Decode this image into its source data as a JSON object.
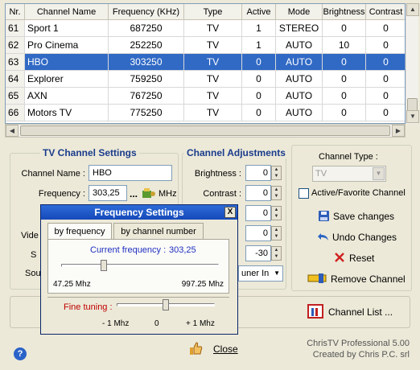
{
  "table": {
    "headers": [
      "Nr.",
      "Channel Name",
      "Frequency (KHz)",
      "Type",
      "Active",
      "Mode",
      "Brightness",
      "Contrast"
    ],
    "rows": [
      {
        "nr": "61",
        "name": "Sport 1",
        "freq": "687250",
        "type": "TV",
        "active": "1",
        "mode": "STEREO",
        "brightness": "0",
        "contrast": "0"
      },
      {
        "nr": "62",
        "name": "Pro Cinema",
        "freq": "252250",
        "type": "TV",
        "active": "1",
        "mode": "AUTO",
        "brightness": "10",
        "contrast": "0"
      },
      {
        "nr": "63",
        "name": "HBO",
        "freq": "303250",
        "type": "TV",
        "active": "0",
        "mode": "AUTO",
        "brightness": "0",
        "contrast": "0"
      },
      {
        "nr": "64",
        "name": "Explorer",
        "freq": "759250",
        "type": "TV",
        "active": "0",
        "mode": "AUTO",
        "brightness": "0",
        "contrast": "0"
      },
      {
        "nr": "65",
        "name": "AXN",
        "freq": "767250",
        "type": "TV",
        "active": "0",
        "mode": "AUTO",
        "brightness": "0",
        "contrast": "0"
      },
      {
        "nr": "66",
        "name": "Motors TV",
        "freq": "775250",
        "type": "TV",
        "active": "0",
        "mode": "AUTO",
        "brightness": "0",
        "contrast": "0"
      }
    ],
    "selected_index": 2
  },
  "tv_settings": {
    "title": "TV Channel Settings",
    "channel_name_label": "Channel Name :",
    "channel_name_value": "HBO",
    "frequency_label": "Frequency :",
    "frequency_value": "303,25",
    "frequency_dots": "...",
    "frequency_unit": "MHz",
    "video_label_partial": "Vide",
    "s_label_partial": "S",
    "sou_label_partial": "Sou"
  },
  "adjustments": {
    "title": "Channel Adjustments",
    "brightness_label": "Brightness :",
    "brightness_value": "0",
    "contrast_label": "Contrast :",
    "contrast_value": "0",
    "row3_value": "0",
    "row4_value": "0",
    "row5_value": "-30",
    "tuner_label_partial": "uner In"
  },
  "right_panel": {
    "channel_type_label": "Channel Type :",
    "channel_type_value": "TV",
    "favorite_label": "Active/Favorite Channel",
    "save_label": "Save changes",
    "undo_label": "Undo Changes",
    "reset_label": "Reset",
    "remove_label": "Remove Channel"
  },
  "bottom": {
    "channel_list_label": "Channel List ...",
    "close_label": "Close",
    "app_name": "ChrisTV Professional 5.00",
    "credit": "Created by Chris P.C. srl"
  },
  "dialog": {
    "title": "Frequency Settings",
    "close_glyph": "X",
    "tab1": "by frequency",
    "tab2": "by channel number",
    "current_label": "Current frequency :",
    "current_value": "303,25",
    "range_min": "47.25 Mhz",
    "range_max": "997.25 Mhz",
    "fine_label": "Fine tuning :",
    "fine_min": "- 1 Mhz",
    "fine_mid": "0",
    "fine_max": "+ 1 Mhz",
    "frequency_position": 0.268,
    "fine_position": 0.5
  },
  "colors": {
    "selection": "#316ac5",
    "group_title": "#1a3c8c",
    "fine_tuning": "#c00000",
    "current_freq": "#1f2fbf"
  },
  "icons": [
    "frequency-tune-icon",
    "save-disk-icon",
    "undo-arrow-icon",
    "reset-x-icon",
    "remove-channel-icon",
    "channel-list-icon",
    "close-thumb-icon",
    "help-icon"
  ]
}
